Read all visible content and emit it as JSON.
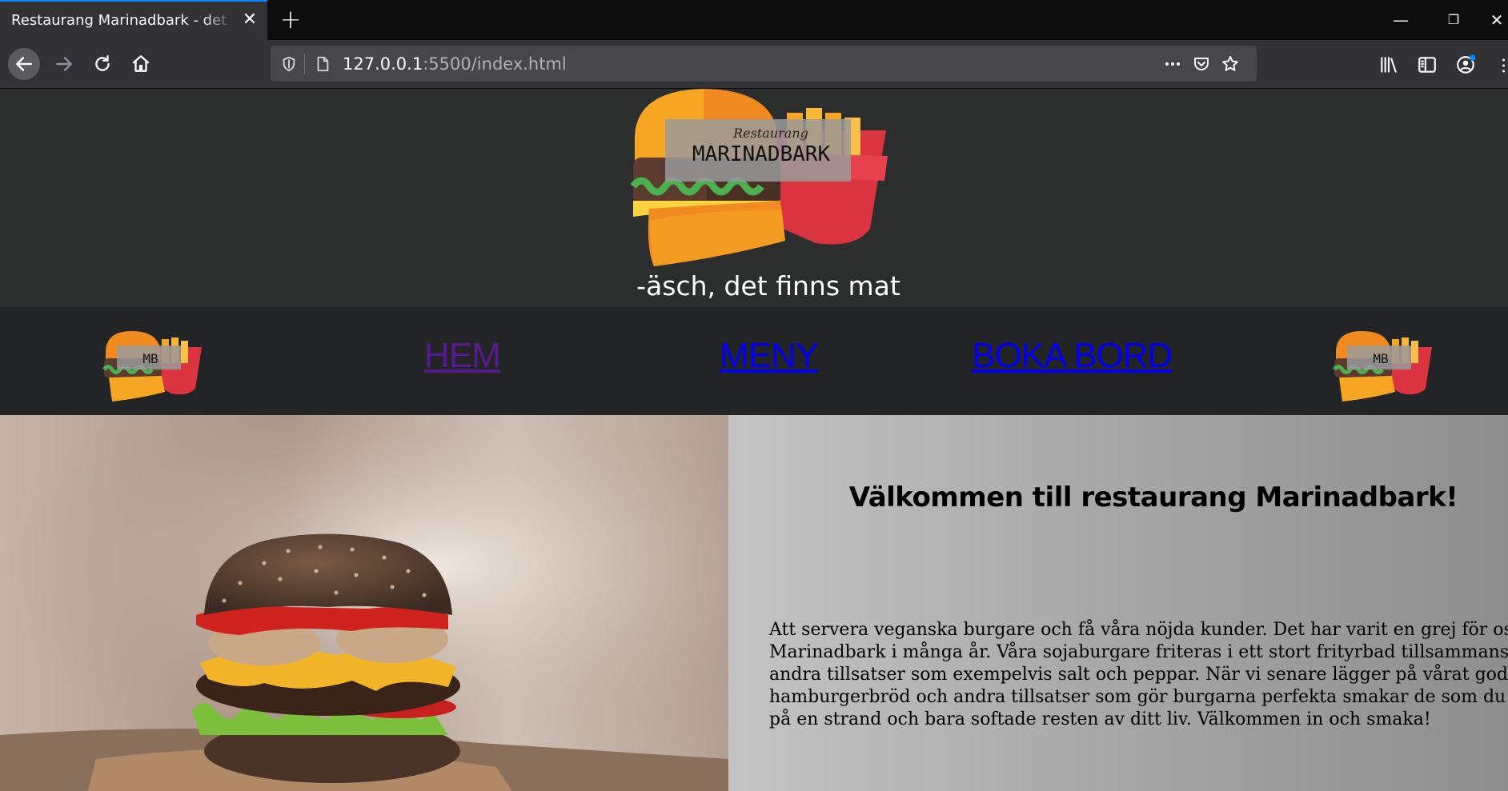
{
  "browser": {
    "tab_title": "Restaurang Marinadbark - det vegansk",
    "tab_close_icon": "close-icon",
    "new_tab_label": "+",
    "window_controls": {
      "minimize": "—",
      "restore": "❐",
      "close": "✕"
    },
    "url": {
      "host": "127.0.0.1",
      "rest": ":5500/index.html"
    }
  },
  "site": {
    "logo": {
      "small_text": "Restaurang",
      "big_text": "MARINADBARK",
      "mini_text": "MB"
    },
    "tagline": "-äsch, det finns mat",
    "nav": [
      {
        "label": "HEM",
        "state": "visited"
      },
      {
        "label": "MENY",
        "state": "link"
      },
      {
        "label": "BOKA BORD",
        "state": "link"
      }
    ],
    "welcome_title": "Välkommen till restaurang Marinadbark!",
    "welcome_body": "Att servera veganska burgare och få våra nöjda kunder. Det har varit en grej för oss på Marinadbark i många år. Våra sojaburgare friteras i ett stort frityrbad tillsammans med andra tillsatser som exempelvis salt och peppar. När vi senare lägger på vårat goda hamburgerbröd och andra tillsatser som gör burgarna perfekta smakar de som du vore på en strand och bara softade resten av ditt liv. Välkommen in och smaka!"
  },
  "colors": {
    "visited_link": "#551a8b",
    "link": "#0000ee",
    "focus_ring": "#0a84ff"
  }
}
